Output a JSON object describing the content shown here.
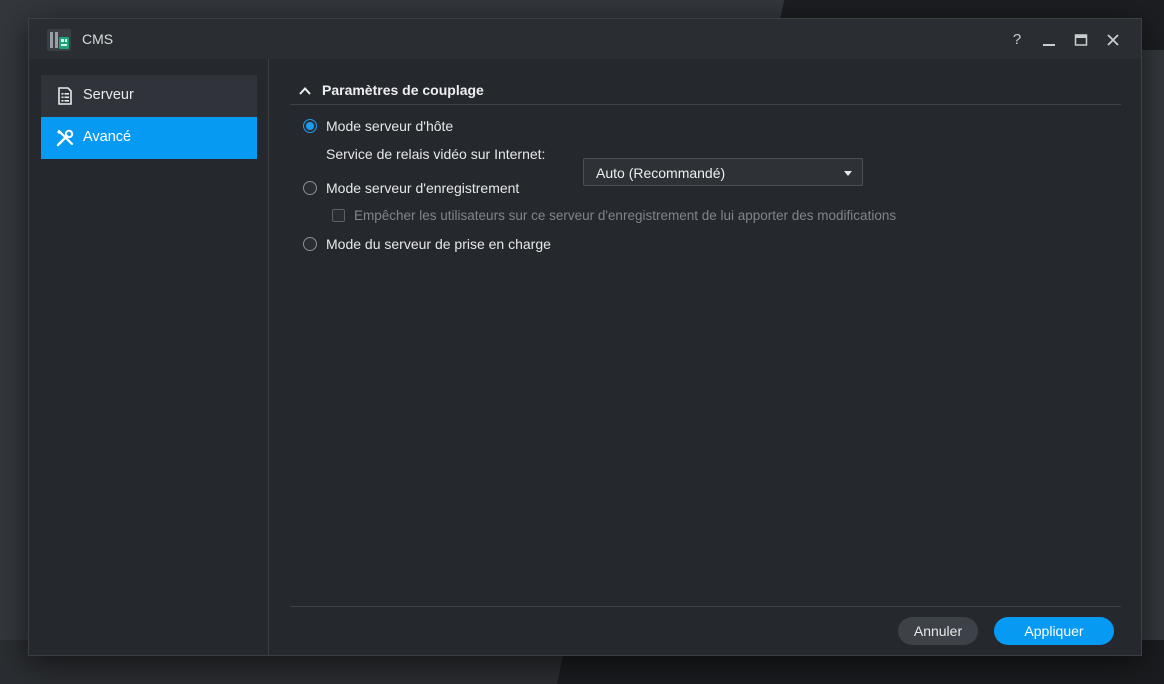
{
  "window": {
    "title": "CMS",
    "controls": {
      "help": "?",
      "minimize": "minimize-icon",
      "maximize": "maximize-icon",
      "close": "close-icon"
    }
  },
  "sidebar": {
    "items": [
      {
        "label": "Serveur",
        "icon": "document-list-icon",
        "active": false
      },
      {
        "label": "Avancé",
        "icon": "tools-icon",
        "active": true
      }
    ]
  },
  "section": {
    "title": "Paramètres de couplage",
    "collapse_icon": "chevron-up-icon"
  },
  "options": {
    "host_mode": {
      "label": "Mode serveur d'hôte",
      "checked": true
    },
    "relay_service": {
      "label": "Service de relais vidéo sur Internet:",
      "value": "Auto (Recommandé)"
    },
    "recording_mode": {
      "label": "Mode serveur d'enregistrement",
      "checked": false
    },
    "prevent_changes": {
      "label": "Empêcher les utilisateurs sur ce serveur d'enregistrement de lui apporter des modifications",
      "checked": false,
      "disabled": true
    },
    "failover_mode": {
      "label": "Mode du serveur de prise en charge",
      "checked": false
    }
  },
  "footer": {
    "cancel_label": "Annuler",
    "apply_label": "Appliquer"
  },
  "colors": {
    "accent": "#069af3",
    "window_bg": "#25282c",
    "sidebar_inactive": "#30343a"
  }
}
